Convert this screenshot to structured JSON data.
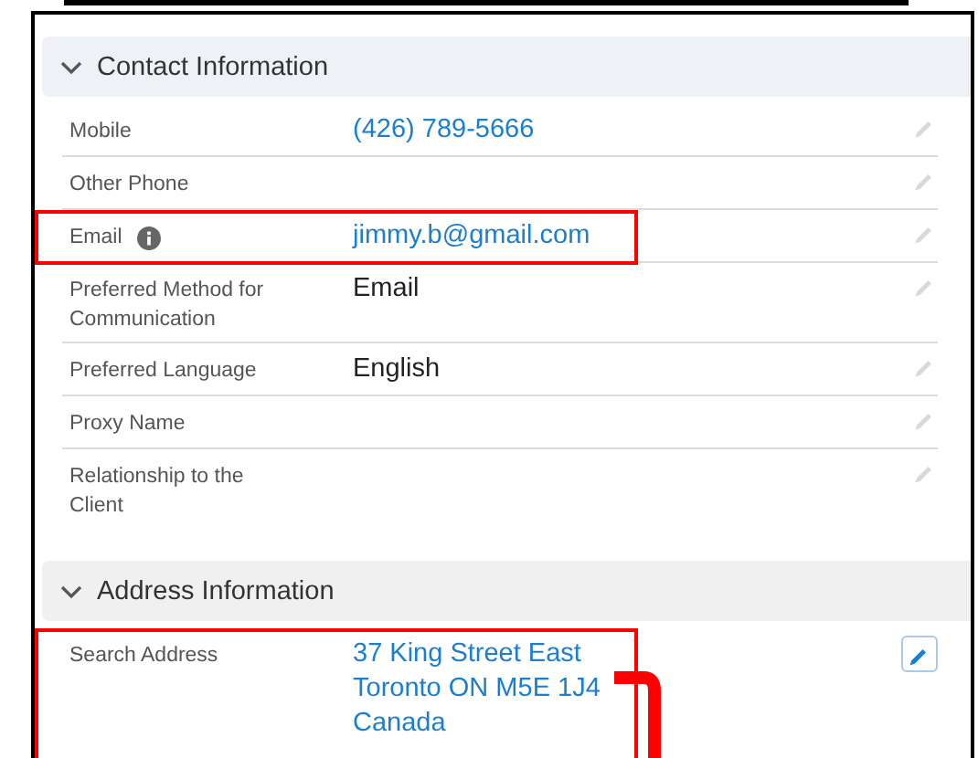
{
  "sections": [
    {
      "title": "Contact Information",
      "expanded": true,
      "fields": [
        {
          "label": "Mobile",
          "value": "(426) 789-5666",
          "kind": "link",
          "highlighted": false,
          "edit_focused": false
        },
        {
          "label": "Other Phone",
          "highlighted": false,
          "edit_focused": false
        },
        {
          "label": "Email",
          "info": true,
          "value": "jimmy.b@gmail.com",
          "kind": "link",
          "highlighted": true,
          "edit_focused": false
        },
        {
          "label": "Preferred Method for Communication",
          "value": "Email",
          "kind": "text",
          "highlighted": false,
          "edit_focused": false
        },
        {
          "label": "Preferred Language",
          "value": "English",
          "kind": "text",
          "highlighted": false,
          "edit_focused": false
        },
        {
          "label": "Proxy Name",
          "highlighted": false,
          "edit_focused": false
        },
        {
          "label": "Relationship to the Client",
          "highlighted": false,
          "edit_focused": false
        }
      ]
    },
    {
      "title": "Address Information",
      "expanded": true,
      "fields": [
        {
          "label": "Search Address",
          "value": "37 King Street East\nToronto ON M5E 1J4\nCanada",
          "kind": "link",
          "highlighted": true,
          "bracket": true,
          "edit_focused": true
        }
      ]
    }
  ]
}
